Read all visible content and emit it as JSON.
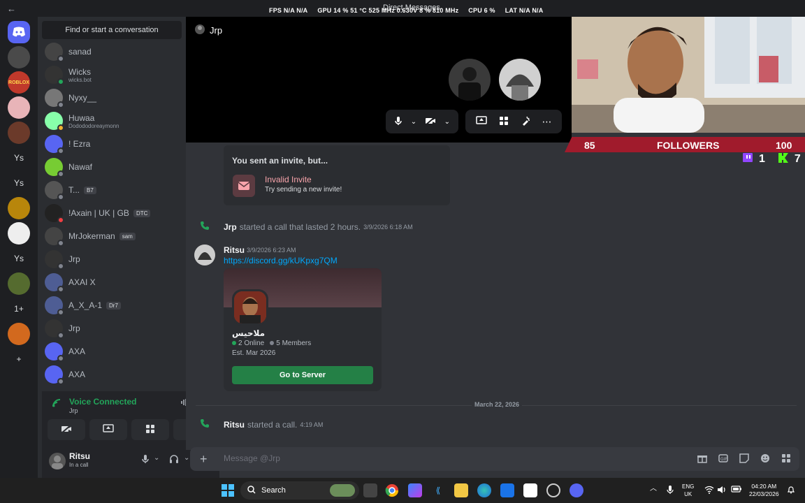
{
  "window": {
    "back_glyph": "←",
    "title": "Direct Messages"
  },
  "overlay": {
    "fps_label": "FPS",
    "fps_val": "N/A",
    "fps_val2": "N/A",
    "gpu_label": "GPU",
    "gpu_val": "14 % 51 °C 525 MHz 0.630V 8 % 810 MHz",
    "cpu_label": "CPU",
    "cpu_val": "6 %",
    "lat_label": "LAT",
    "lat_val": "N/A",
    "lat_val2": "N/A"
  },
  "guilds": [
    {
      "label": "",
      "type": "home"
    },
    {
      "label": "",
      "type": "img",
      "color": "#4a4a4a"
    },
    {
      "label": "ROBLOX",
      "type": "img",
      "color": "#c0392b"
    },
    {
      "label": "",
      "type": "img",
      "color": "#e8b4b8"
    },
    {
      "label": "",
      "type": "img",
      "color": "#6b3a2a"
    },
    {
      "label": "Ys",
      "type": "txt"
    },
    {
      "label": "Ys",
      "type": "txt"
    },
    {
      "label": "",
      "type": "img",
      "color": "#b8860b"
    },
    {
      "label": "",
      "type": "img",
      "color": "#eeeeee"
    },
    {
      "label": "Ys",
      "type": "txt"
    },
    {
      "label": "",
      "type": "img",
      "color": "#556b2f"
    },
    {
      "label": "1+",
      "type": "txt"
    },
    {
      "label": "",
      "type": "img",
      "color": "#d2691e"
    },
    {
      "label": "+",
      "type": "txt"
    }
  ],
  "dms": {
    "find": "Find or start a conversation",
    "items": [
      {
        "name": "sanad",
        "sub": "",
        "tag": "",
        "status": "offline",
        "color": "#444"
      },
      {
        "name": "Wicks",
        "sub": "wicks.bot",
        "tag": "",
        "status": "on",
        "color": "#333"
      },
      {
        "name": "Nyxy__",
        "sub": "",
        "tag": "",
        "status": "offline",
        "color": "#777"
      },
      {
        "name": "Huwaa",
        "sub": "Dodododoreaymonn",
        "tag": "",
        "status": "idle",
        "color": "#8fa"
      },
      {
        "name": "! Ezra",
        "sub": "",
        "tag": "",
        "status": "offline",
        "color": "#5865f2"
      },
      {
        "name": "Nawaf",
        "sub": "",
        "tag": "",
        "status": "offline",
        "color": "#7c3"
      },
      {
        "name": "T...",
        "sub": "",
        "tag": "B7",
        "status": "offline",
        "color": "#555"
      },
      {
        "name": "!Axain | UK | GB",
        "sub": "",
        "tag": "DTC",
        "status": "dnd",
        "color": "#222"
      },
      {
        "name": "MrJokerman",
        "sub": "",
        "tag": "sam",
        "status": "offline",
        "color": "#444"
      },
      {
        "name": "Jrp",
        "sub": "",
        "tag": "",
        "status": "offline",
        "color": "#333"
      },
      {
        "name": "AXAI X",
        "sub": "",
        "tag": "",
        "status": "offline",
        "color": "#4e5d94"
      },
      {
        "name": "A_X_A-1",
        "sub": "",
        "tag": "Dr7",
        "status": "offline",
        "color": "#4e5d94"
      },
      {
        "name": "Jrp",
        "sub": "",
        "tag": "",
        "status": "offline",
        "color": "#333"
      },
      {
        "name": "AXA",
        "sub": "",
        "tag": "",
        "status": "offline",
        "color": "#5865f2"
      },
      {
        "name": "AXA",
        "sub": "",
        "tag": "",
        "status": "offline",
        "color": "#5865f2"
      }
    ]
  },
  "voice": {
    "title": "Voice Connected",
    "channel": "Jrp"
  },
  "user": {
    "name": "Ritsu",
    "status": "In a call"
  },
  "call": {
    "name": "Jrp"
  },
  "stream": {
    "followers_num": "85",
    "followers_label": "FOLLOWERS",
    "followers_goal": "100",
    "twitch_count": "1",
    "kick_count": "7"
  },
  "chat": {
    "invite": {
      "heading": "You sent an invite, but...",
      "title": "Invalid Invite",
      "subtitle": "Try sending a new invite!"
    },
    "call1": {
      "author": "Jrp",
      "text": "started a call that lasted 2 hours.",
      "ts": "3/9/2026 6:18 AM"
    },
    "msg": {
      "author": "Ritsu",
      "ts": "3/9/2026 6:23 AM",
      "link": "https://discord.gg/kUKpxg7QM"
    },
    "server": {
      "name": "ملاحيس",
      "online": "2 Online",
      "members": "5 Members",
      "est": "Est. Mar 2026",
      "button": "Go to Server"
    },
    "divider": "March 22, 2026",
    "call2": {
      "author": "Ritsu",
      "text": "started a call.",
      "ts": "4:19 AM"
    }
  },
  "composer": {
    "placeholder": "Message @Jrp"
  },
  "taskbar": {
    "search": "Search",
    "lang1": "ENG",
    "lang2": "UK",
    "time": "04:20 AM",
    "date": "22/03/2026"
  },
  "colors": {
    "accent": "#5865f2",
    "online": "#23a55a",
    "link": "#00a8fc",
    "followers_bar": "#a01b2c"
  }
}
